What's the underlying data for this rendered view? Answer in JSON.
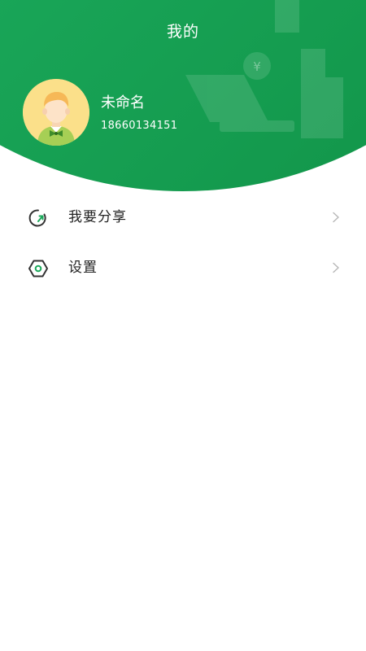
{
  "header": {
    "title": "我的",
    "deco_glyph": "¥"
  },
  "profile": {
    "name": "未命名",
    "phone": "18660134151"
  },
  "menu": {
    "items": [
      {
        "label": "我要分享",
        "icon": "share-icon"
      },
      {
        "label": "设置",
        "icon": "settings-icon"
      }
    ]
  },
  "colors": {
    "brand_green": "#1aa85a",
    "text": "#222222",
    "chevron": "#b8b8b8",
    "avatar_bg": "#fbe08a"
  }
}
